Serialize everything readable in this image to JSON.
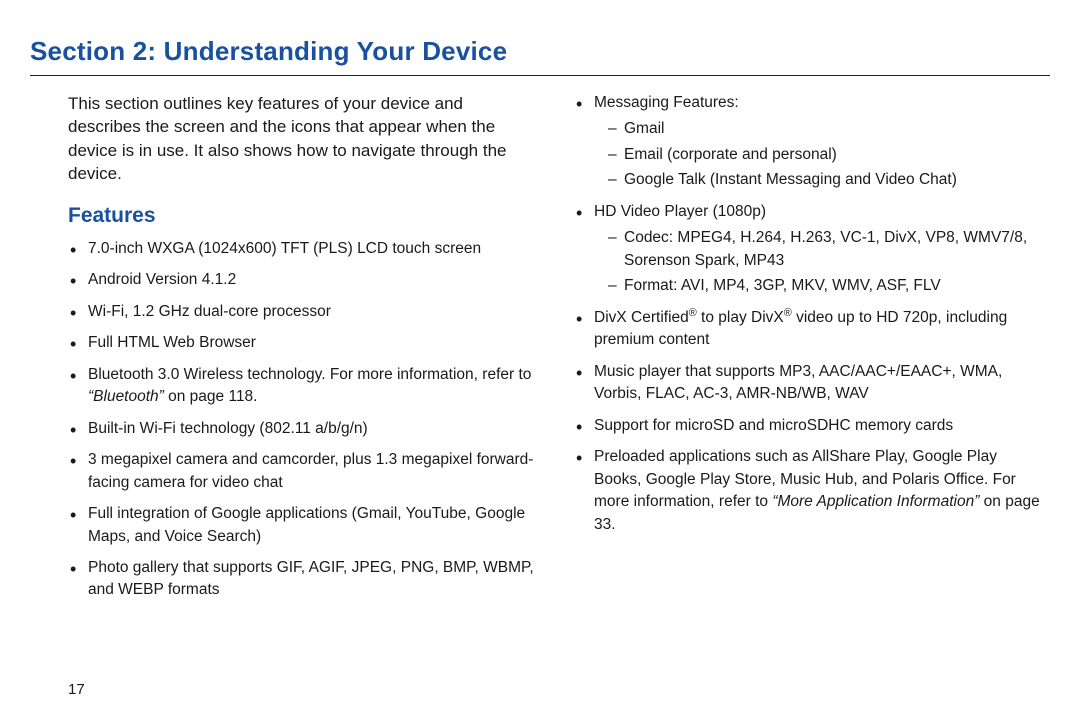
{
  "sectionTitle": "Section 2: Understanding Your Device",
  "intro": "This section outlines key features of your device and describes the screen and the icons that appear when the device is in use. It also shows how to navigate through the device.",
  "subhead": "Features",
  "left": {
    "f1": "7.0-inch WXGA (1024x600) TFT (PLS) LCD touch screen",
    "f2": "Android Version 4.1.2",
    "f3": "Wi-Fi, 1.2 GHz dual-core processor",
    "f4": "Full HTML Web Browser",
    "f5pre": "Bluetooth 3.0 Wireless technology. For more information, refer to ",
    "f5xref": "“Bluetooth”",
    "f5post": " on page 118.",
    "f6": "Built-in Wi-Fi technology (802.11 a/b/g/n)",
    "f7": "3 megapixel camera and camcorder, plus 1.3 megapixel forward-facing camera for video chat",
    "f8": "Full integration of Google applications (Gmail, YouTube, Google Maps, and Voice Search)",
    "f9": "Photo gallery that supports GIF, AGIF, JPEG, PNG, BMP, WBMP, and WEBP formats"
  },
  "right": {
    "msgHead": "Messaging Features:",
    "msg1": "Gmail",
    "msg2": "Email (corporate and personal)",
    "msg3": "Google Talk (Instant Messaging and Video Chat)",
    "hdHead": "HD Video Player (1080p)",
    "hd1": "Codec: MPEG4, H.264, H.263, VC-1, DivX, VP8, WMV7/8, Sorenson Spark, MP43",
    "hd2": "Format: AVI, MP4, 3GP, MKV, WMV, ASF, FLV",
    "divxA": "DivX Certified",
    "divxB": " to play DivX",
    "divxC": " video up to HD 720p, including premium content",
    "music": "Music player that supports MP3, AAC/AAC+/EAAC+, WMA, Vorbis, FLAC, AC-3, AMR-NB/WB, WAV",
    "sd": "Support for microSD and microSDHC memory cards",
    "preloadPre": "Preloaded applications such as AllShare Play, Google Play Books, Google Play Store, Music Hub, and Polaris Office. For more information, refer to ",
    "preloadXref": "“More Application Information”",
    "preloadPost": " on page 33."
  },
  "pageNum": "17",
  "reg": "®"
}
